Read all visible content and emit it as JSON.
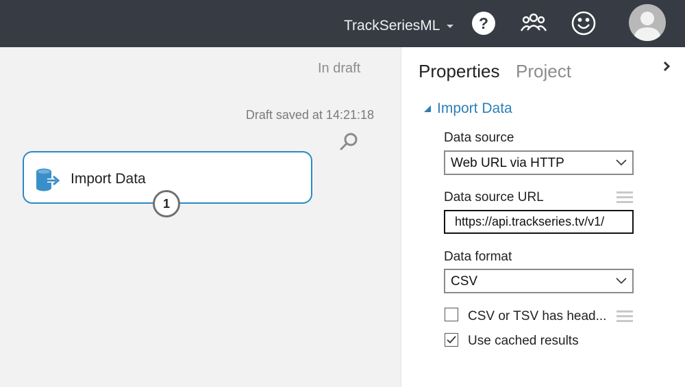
{
  "header": {
    "workspace_name": "TrackSeriesML",
    "icons": [
      "help-icon",
      "community-icon",
      "feedback-smiley-icon",
      "user-avatar"
    ]
  },
  "canvas": {
    "status": "In draft",
    "draft_saved": "Draft saved at 14:21:18",
    "module": {
      "label": "Import Data",
      "icon": "import-data-icon",
      "output_port": "1"
    }
  },
  "panel": {
    "tabs": [
      "Properties",
      "Project"
    ],
    "section_title": "Import Data",
    "data_source": {
      "label": "Data source",
      "value": "Web URL via HTTP"
    },
    "data_source_url": {
      "label": "Data source URL",
      "value": "https://api.trackseries.tv/v1/"
    },
    "data_format": {
      "label": "Data format",
      "value": "CSV"
    },
    "checkboxes": [
      {
        "label": "CSV or TSV has head...",
        "checked": false
      },
      {
        "label": "Use cached results",
        "checked": true
      }
    ]
  },
  "colors": {
    "topbar": "#363b44",
    "accent": "#2b7fb8",
    "module_border": "#2b88c6"
  }
}
